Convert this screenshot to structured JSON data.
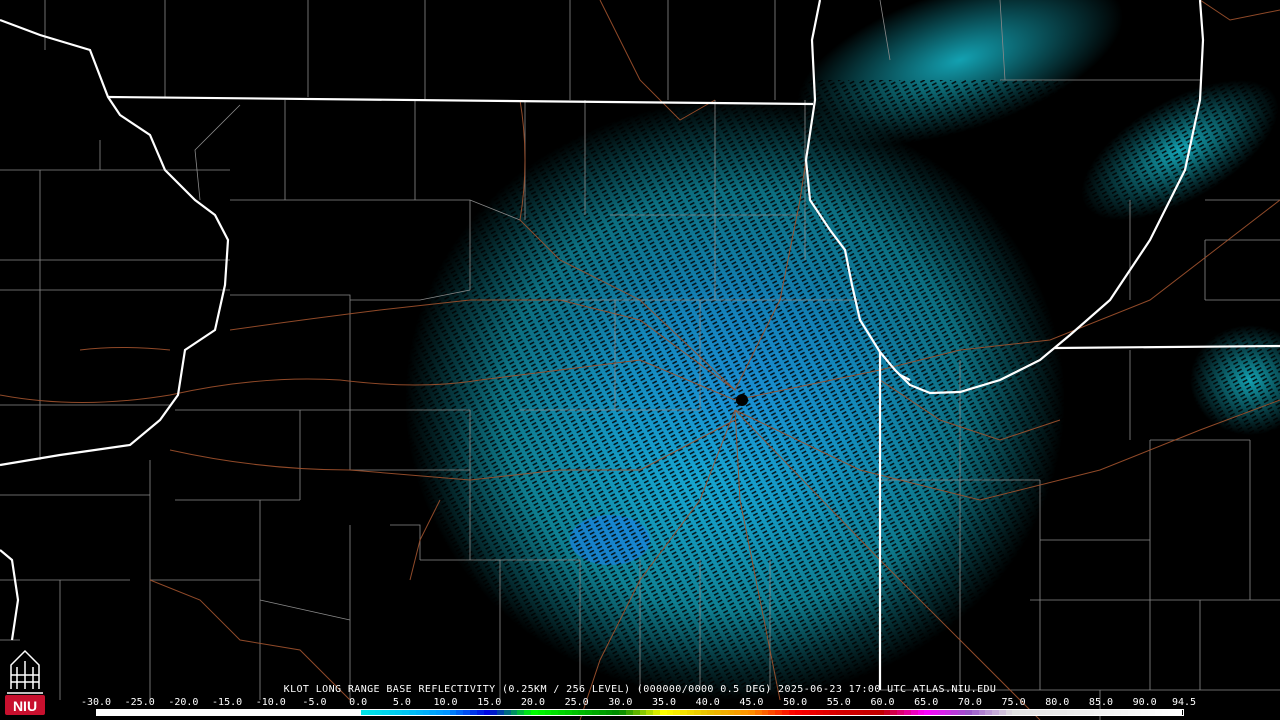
{
  "caption": "KLOT LONG RANGE BASE REFLECTIVITY (0.25KM / 256 LEVEL) (000000/0000 0.5 DEG) 2025-06-23 17:00 UTC  ATLAS.NIU.EDU",
  "logo": {
    "text": "NIU",
    "background_color": "#c8102e"
  },
  "radar_site_marker": "radar-site",
  "color_scale": {
    "labels": [
      "-30.0",
      "-25.0",
      "-20.0",
      "-15.0",
      "-10.0",
      "-5.0",
      "0.0",
      "5.0",
      "10.0",
      "15.0",
      "20.0",
      "25.0",
      "30.0",
      "35.0",
      "40.0",
      "45.0",
      "50.0",
      "55.0",
      "60.0",
      "65.0",
      "70.0",
      "75.0",
      "80.0",
      "85.0",
      "90.0",
      "94.5"
    ],
    "min": -30.0,
    "max": 94.5,
    "stops": [
      {
        "value": -30,
        "color": "#ffffff"
      },
      {
        "value": 0,
        "color": "#ffffff"
      },
      {
        "value": 0.5,
        "color": "#00e5e5"
      },
      {
        "value": 5,
        "color": "#00c8f0"
      },
      {
        "value": 10,
        "color": "#0096ff"
      },
      {
        "value": 15,
        "color": "#0000e0"
      },
      {
        "value": 20,
        "color": "#00ff00"
      },
      {
        "value": 25,
        "color": "#00c000"
      },
      {
        "value": 30,
        "color": "#008800"
      },
      {
        "value": 35,
        "color": "#ffff00"
      },
      {
        "value": 40,
        "color": "#e7c000"
      },
      {
        "value": 45,
        "color": "#ff9000"
      },
      {
        "value": 50,
        "color": "#ff0000"
      },
      {
        "value": 55,
        "color": "#d60000"
      },
      {
        "value": 60,
        "color": "#c00000"
      },
      {
        "value": 65,
        "color": "#ff00ff"
      },
      {
        "value": 70,
        "color": "#9955c9"
      },
      {
        "value": 75,
        "color": "#e0e0e0"
      },
      {
        "value": 94.5,
        "color": "#ffffff"
      }
    ]
  }
}
